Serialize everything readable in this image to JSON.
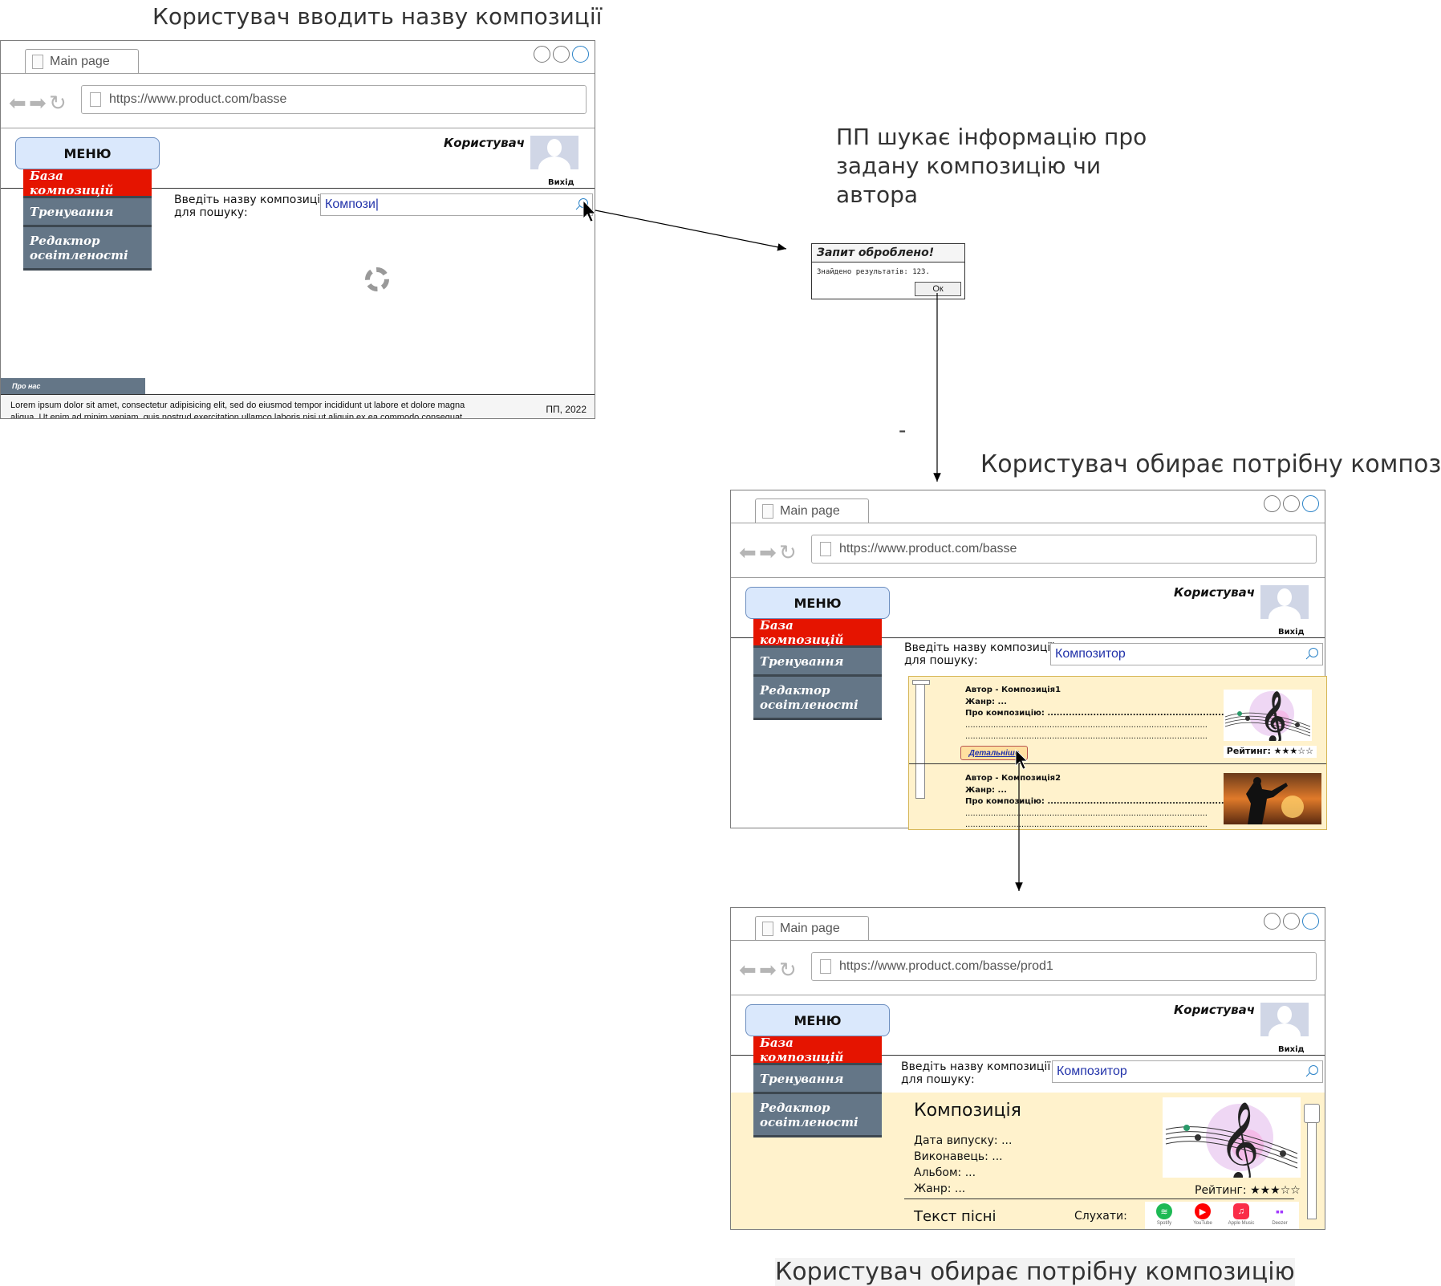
{
  "captions": {
    "step1": "Користувач вводить назву композиції",
    "step2": "ПП шукає інформацію про задану композицію чи автора",
    "step3": "Користувач обирає потрібну композицію",
    "step4": "Користувач обирає потрібну композицію",
    "dash": "-"
  },
  "common": {
    "tab_title": "Main page",
    "menu_label": "МЕНЮ",
    "menu_items": [
      "База композицій",
      "Тренування",
      "Редактор освітленості"
    ],
    "user_name": "Користувач",
    "logout": "Вихід",
    "search_label": "Введіть назву композиції для пошуку:"
  },
  "screen1": {
    "url": "https://www.product.com/basse",
    "search_value": "Компози|",
    "about": "Про нас",
    "footer_text": "Lorem ipsum dolor sit amet, consectetur adipisicing elit, sed do eiusmod tempor incididunt ut labore et dolore magna aliqua. Ut enim ad minim veniam, quis nostrud exercitation ullamco laboris nisi ut aliquip ex ea commodo consequat. Duis aute irure dolor in reprehenderit in voluptate velit esse cillum dolore eu fugiat nulla pariatur. Excepteur sint occaecat cupidatat non proident, sunt in culpa qui officia deserunt mollit anim id est laborum.",
    "copyright": "ПП, 2022"
  },
  "dialog": {
    "title": "Запит оброблено!",
    "text": "Знайдено результатів: 123.",
    "ok": "Ок"
  },
  "screen2": {
    "url": "https://www.product.com/basse",
    "search_value": "Композитор",
    "results": [
      {
        "title": "Автор - Композиція1",
        "genre": "Жанр: ...",
        "about": "Про композицію: .............................................................",
        "dots1": "...............................................................................................",
        "dots2": "...............................................................................................",
        "rating": "Рейтинг: ★★★☆☆",
        "details": "Детальніше"
      },
      {
        "title": "Автор - Композиція2",
        "genre": "Жанр: ...",
        "about": "Про композицію: .............................................................",
        "dots1": "...............................................................................................",
        "dots2": "..............................................................................................."
      }
    ]
  },
  "screen3": {
    "url": "https://www.product.com/basse/prod1",
    "search_value": "Композитор",
    "title": "Композиція",
    "fields": [
      "Дата випуску: ...",
      "Виконавець: ...",
      "Альбом: ...",
      "Жанр: ..."
    ],
    "rating": "Рейтинг: ★★★☆☆",
    "lyrics": "Текст пісні",
    "listen": "Слухати:",
    "services": [
      "Spotify",
      "YouTube",
      "Apple Music",
      "Deezer"
    ]
  },
  "colors": {
    "active_menu": "#e51400",
    "menu_bg": "#647687",
    "menu_button": "#dae8fc",
    "results_bg": "#fff2cc",
    "spotify": "#1db954",
    "youtube": "#ff0000",
    "apple_music": "#fa2d48",
    "deezer": "#a238ff"
  }
}
